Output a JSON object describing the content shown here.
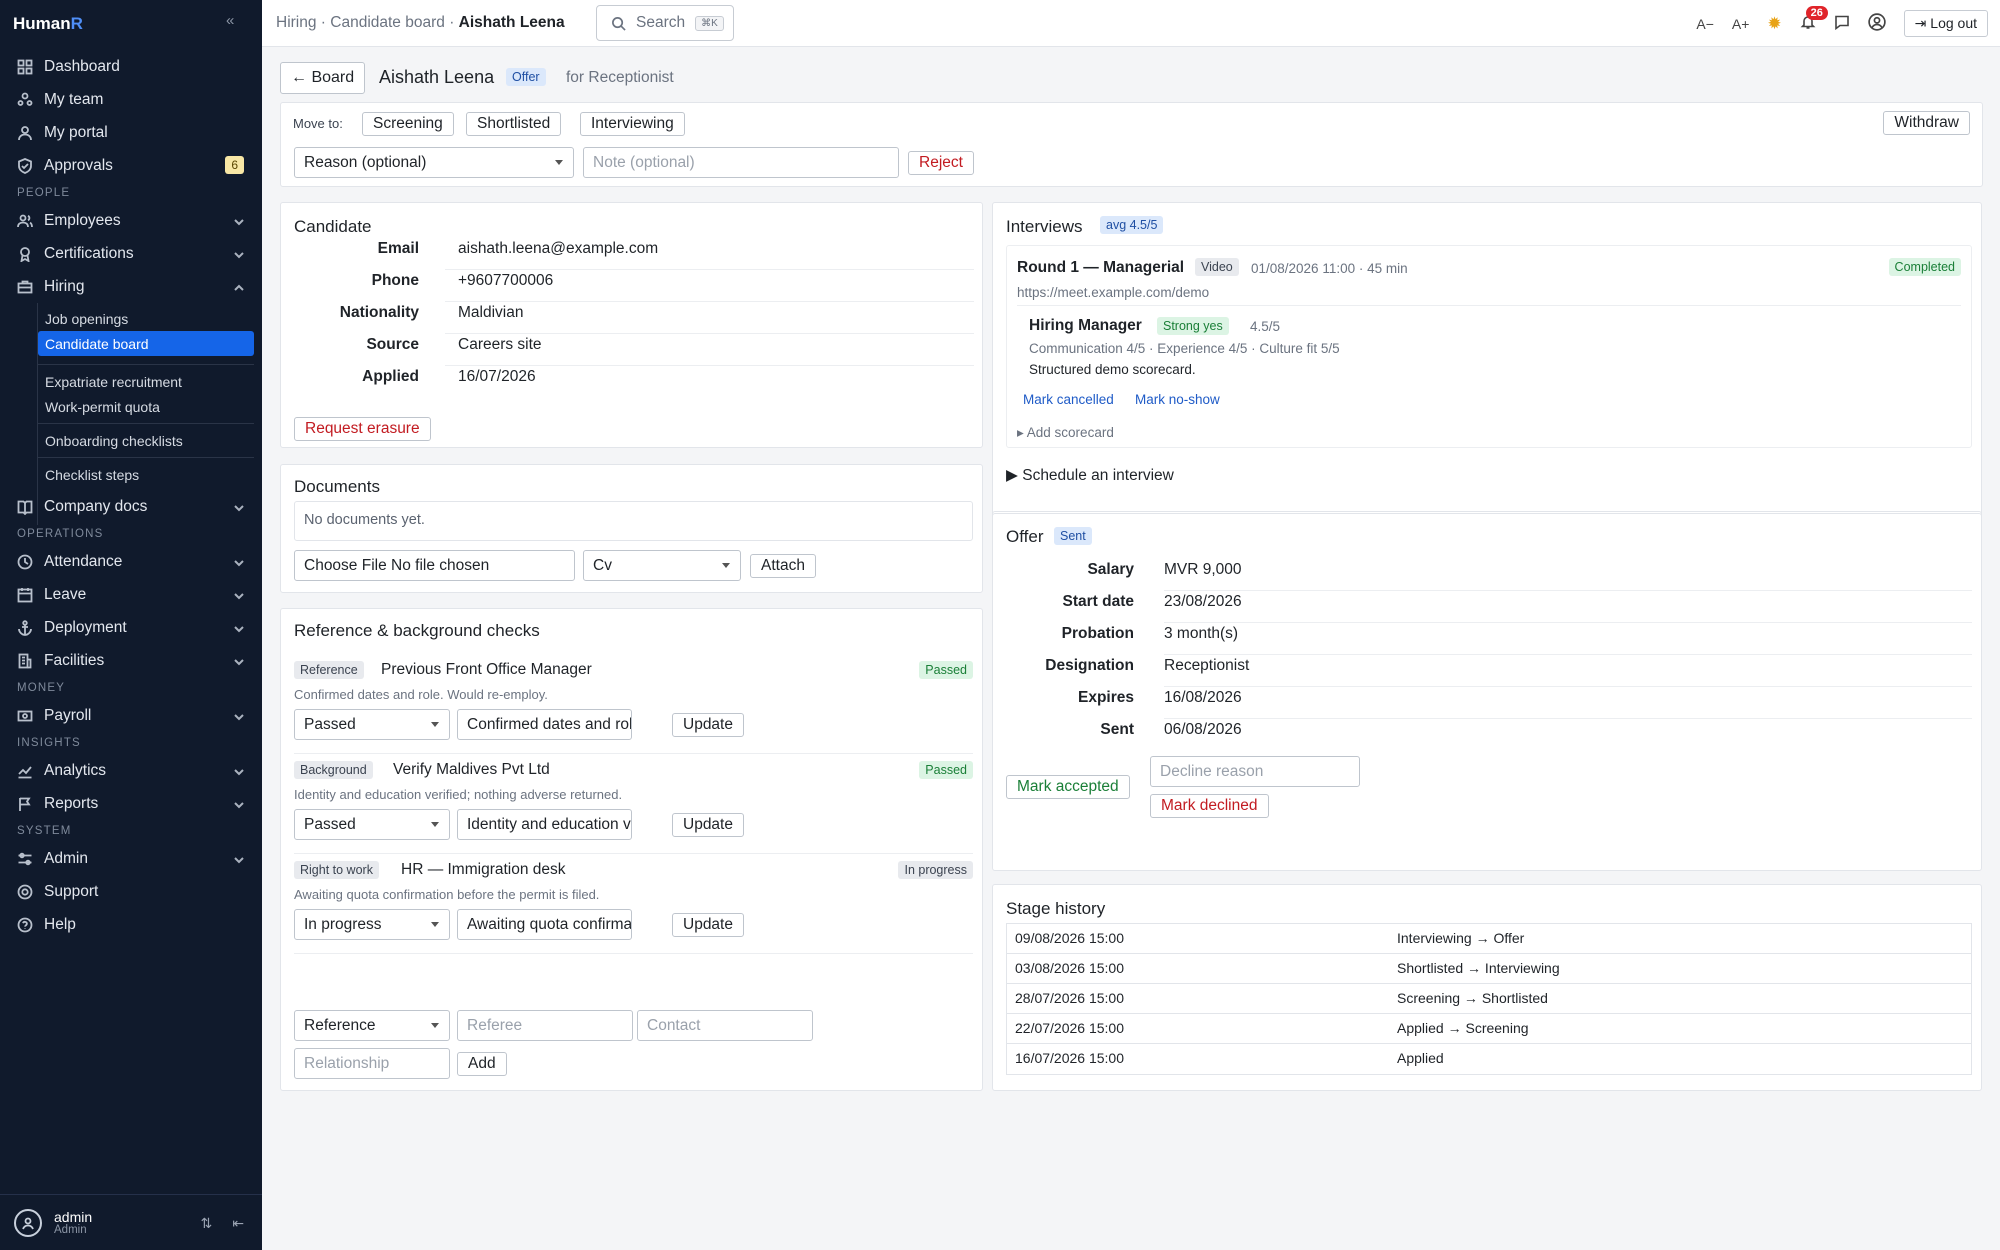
{
  "app": {
    "brand_main": "Human",
    "brand_accent": "R"
  },
  "sidebar": {
    "items": [
      {
        "label": "Dashboard",
        "icon": "grid-icon"
      },
      {
        "label": "My team",
        "icon": "team-icon"
      },
      {
        "label": "My portal",
        "icon": "user-icon"
      },
      {
        "label": "Approvals",
        "icon": "shield-check-icon",
        "badge": "6"
      }
    ],
    "section_people": "PEOPLE",
    "people": [
      {
        "label": "Employees",
        "icon": "users-icon"
      },
      {
        "label": "Certifications",
        "icon": "award-icon"
      },
      {
        "label": "Hiring",
        "icon": "briefcase-icon"
      }
    ],
    "hiring_sub": [
      "Job openings",
      "Candidate board",
      "Expatriate recruitment",
      "Work-permit quota",
      "Onboarding checklists",
      "Checklist steps"
    ],
    "company_docs": "Company docs",
    "section_operations": "OPERATIONS",
    "operations": [
      "Attendance",
      "Leave",
      "Deployment",
      "Facilities"
    ],
    "section_money": "MONEY",
    "payroll": "Payroll",
    "section_insights": "INSIGHTS",
    "insights": [
      "Analytics",
      "Reports"
    ],
    "section_system": "SYSTEM",
    "system": [
      "Admin",
      "Support",
      "Help"
    ],
    "user": {
      "name": "admin",
      "role": "Admin"
    }
  },
  "topbar": {
    "crumb1": "Hiring",
    "crumb2": "Candidate board",
    "crumb3": "Aishath Leena",
    "search": "Search",
    "search_kbd": "⌘K",
    "font_smaller": "A−",
    "font_larger": "A+",
    "notif_count": "26",
    "logout": "Log out"
  },
  "header": {
    "back": "← Board",
    "name": "Aishath Leena",
    "stage_tag": "Offer",
    "role": "for Receptionist"
  },
  "move": {
    "label": "Move to:",
    "stages": [
      "Screening",
      "Shortlisted",
      "Interviewing"
    ],
    "withdraw": "Withdraw",
    "reason_placeholder": "Reason (optional)",
    "note_placeholder": "Note (optional)",
    "reject": "Reject"
  },
  "candidate": {
    "title": "Candidate",
    "fields": [
      {
        "k": "Email",
        "v": "aishath.leena@example.com"
      },
      {
        "k": "Phone",
        "v": "+9607700006"
      },
      {
        "k": "Nationality",
        "v": "Maldivian"
      },
      {
        "k": "Source",
        "v": "Careers site"
      },
      {
        "k": "Applied",
        "v": "16/07/2026"
      }
    ],
    "erasure": "Request erasure"
  },
  "documents": {
    "title": "Documents",
    "empty": "No documents yet.",
    "file": "Choose File No file chosen",
    "type": "Cv",
    "attach": "Attach"
  },
  "checks": {
    "title": "Reference & background checks",
    "items": [
      {
        "type": "Reference",
        "name": "Previous Front Office Manager",
        "status": "Passed",
        "note": "Confirmed dates and role. Would re-employ.",
        "select": "Passed",
        "input": "Confirmed dates and role.",
        "update": "Update"
      },
      {
        "type": "Background",
        "name": "Verify Maldives Pvt Ltd",
        "status": "Passed",
        "note": "Identity and education verified; nothing adverse returned.",
        "select": "Passed",
        "input": "Identity and education veri",
        "update": "Update"
      },
      {
        "type": "Right to work",
        "name": "HR — Immigration desk",
        "status": "In progress",
        "note": "Awaiting quota confirmation before the permit is filed.",
        "select": "In progress",
        "input": "Awaiting quota confirmatic",
        "update": "Update"
      }
    ],
    "new_type": "Reference",
    "referee_ph": "Referee",
    "contact_ph": "Contact",
    "relationship_ph": "Relationship",
    "add": "Add"
  },
  "interviews": {
    "title": "Interviews",
    "avg": "avg 4.5/5",
    "round": "Round 1 — Managerial",
    "mode": "Video",
    "when": "01/08/2026 11:00 · 45 min",
    "status": "Completed",
    "url": "https://meet.example.com/demo",
    "reviewer": "Hiring Manager",
    "verdict": "Strong yes",
    "score": "4.5/5",
    "breakdown": "Communication 4/5 · Experience 4/5 · Culture fit 5/5",
    "comment": "Structured demo scorecard.",
    "mark_cancelled": "Mark cancelled",
    "mark_noshow": "Mark no-show",
    "add_scorecard": "▸ Add scorecard",
    "schedule": "▶ Schedule an interview"
  },
  "offer": {
    "title": "Offer",
    "status": "Sent",
    "fields": [
      {
        "k": "Salary",
        "v": "MVR 9,000"
      },
      {
        "k": "Start date",
        "v": "23/08/2026"
      },
      {
        "k": "Probation",
        "v": "3 month(s)"
      },
      {
        "k": "Designation",
        "v": "Receptionist"
      },
      {
        "k": "Expires",
        "v": "16/08/2026"
      },
      {
        "k": "Sent",
        "v": "06/08/2026"
      }
    ],
    "accept": "Mark accepted",
    "decline_ph": "Decline reason",
    "decline": "Mark declined"
  },
  "history": {
    "title": "Stage history",
    "rows": [
      {
        "t": "09/08/2026 15:00",
        "s": "Interviewing → Offer"
      },
      {
        "t": "03/08/2026 15:00",
        "s": "Shortlisted → Interviewing"
      },
      {
        "t": "28/07/2026 15:00",
        "s": "Screening → Shortlisted"
      },
      {
        "t": "22/07/2026 15:00",
        "s": "Applied → Screening"
      },
      {
        "t": "16/07/2026 15:00",
        "s": "Applied"
      }
    ]
  }
}
